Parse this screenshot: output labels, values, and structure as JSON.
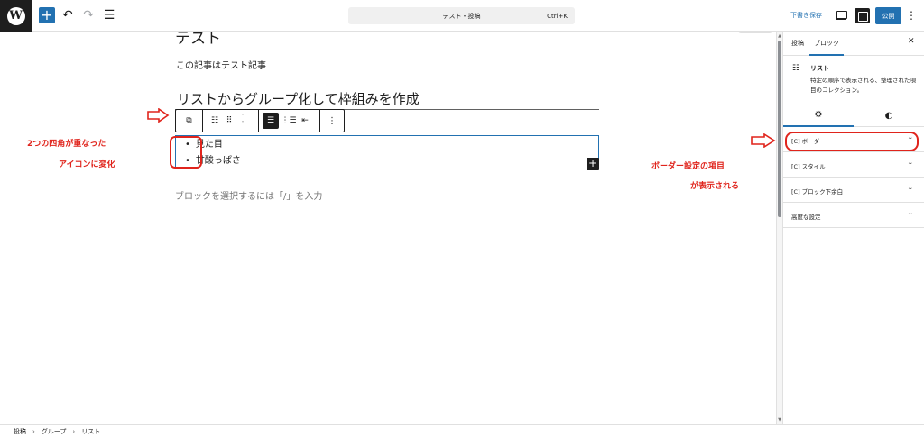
{
  "topbar": {
    "logo_glyph": "W",
    "add_glyph": "+",
    "undo_glyph": "↶",
    "redo_glyph": "↷",
    "list_glyph": "☰",
    "command_title": "テスト・投稿",
    "command_shortcut": "Ctrl+K",
    "save_draft": "下書き保存",
    "publish": "公開",
    "more_glyph": "⋮"
  },
  "editor": {
    "title_partial": "テスト",
    "paragraph": "この記事はテスト記事",
    "heading": "リストからグループ化して枠組みを作成",
    "list_items": [
      "見た目",
      "甘酸っぱさ"
    ],
    "add_block_glyph": "+",
    "block_hint": "ブロックを選択するには「/」を入力"
  },
  "block_toolbar": {
    "group_glyph": "⧉",
    "list_icon_glyph": "☷",
    "drag_glyph": "⠿",
    "move_up_glyph": "˄",
    "move_down_glyph": "˅",
    "unordered_glyph": "☰",
    "ordered_glyph": "⋮☰",
    "outdent_glyph": "⇤",
    "options_glyph": "⋮"
  },
  "annotations": {
    "left_line1": "2つの四角が重なった",
    "left_line2": "アイコンに変化",
    "right_line1": "ボーダー設定の項目",
    "right_line2": "が表示される",
    "arrow_glyph": "⇨",
    "color": "#e0241c"
  },
  "sidebar": {
    "tab_post": "投稿",
    "tab_block": "ブロック",
    "close_glyph": "✕",
    "block_icon_glyph": "☷",
    "block_name": "リスト",
    "block_description": "特定の順序で表示される、整理された項目のコレクション。",
    "settings_tab_glyph": "⚙",
    "styles_tab_glyph": "◐",
    "panels": [
      {
        "title": "[C] ボーダー",
        "chevron": "⌄"
      },
      {
        "title": "[C] スタイル",
        "chevron": "⌄"
      },
      {
        "title": "[C] ブロック下余白",
        "chevron": "⌄"
      },
      {
        "title": "高度な設定",
        "chevron": "⌄"
      }
    ]
  },
  "breadcrumb": {
    "items": [
      "投稿",
      "グループ",
      "リスト"
    ],
    "sep": "›"
  },
  "colors": {
    "accent": "#2271b1",
    "dark": "#1e1e1e",
    "annotation": "#e0241c"
  }
}
